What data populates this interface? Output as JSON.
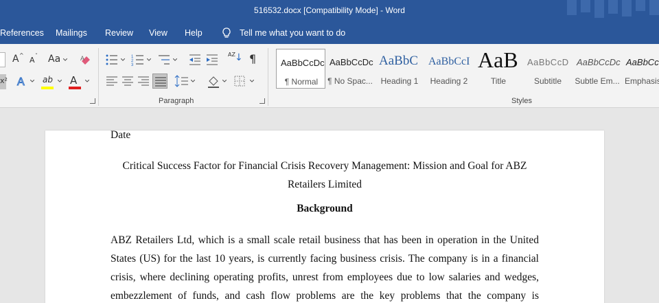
{
  "window": {
    "title": "516532.docx [Compatibility Mode]  -  Word"
  },
  "tabs": [
    {
      "label": "References"
    },
    {
      "label": "Mailings"
    },
    {
      "label": "Review"
    },
    {
      "label": "View"
    },
    {
      "label": "Help"
    }
  ],
  "tellme": {
    "label": "Tell me what you want to do",
    "icon": "lightbulb-icon"
  },
  "ribbon": {
    "font_group": {
      "grow_glyph": "A",
      "shrink_glyph": "A",
      "change_case_glyph": "Aa",
      "clear_format_icon": "eraser-icon",
      "text_effects_glyph": "A",
      "highlight_glyph": "ab",
      "font_color_glyph": "A",
      "highlight_color": "#ffff00",
      "font_color": "#e02020",
      "superscript_glyph": "x²"
    },
    "paragraph_group": {
      "label": "Paragraph",
      "sort_glyph": "AZ",
      "pilcrow_glyph": "¶"
    },
    "styles_group": {
      "label": "Styles",
      "styles": [
        {
          "preview": "AaBbCcDc",
          "name": "¶ Normal",
          "selected": true
        },
        {
          "preview": "AaBbCcDc",
          "name": "¶ No Spac..."
        },
        {
          "preview": "AaBbC",
          "name": "Heading 1"
        },
        {
          "preview": "AaBbCcI",
          "name": "Heading 2"
        },
        {
          "preview": "AaB",
          "name": "Title"
        },
        {
          "preview": "AaBbCcD",
          "name": "Subtitle"
        },
        {
          "preview": "AaBbCcDc",
          "name": "Subtle Em..."
        },
        {
          "preview": "AaBbCcl",
          "name": "Emphasis"
        }
      ]
    }
  },
  "document": {
    "date": "Date",
    "title_line1": "Critical Success Factor for Financial Crisis Recovery Management: Mission and Goal for ABZ",
    "title_line2": "Retailers Limited",
    "heading": "Background",
    "para_line1": "ABZ Retailers Ltd, which is a small scale retail business that has been in operation in the United",
    "para_line2": "States (US) for the last 10 years, is currently facing business crisis. The company is in a financial",
    "para_line3": "crisis, where declining operating profits, unrest from employees due to low salaries and wedges,",
    "para_line4": "embezzlement of funds, and cash flow problems are the key problems that the company is"
  }
}
